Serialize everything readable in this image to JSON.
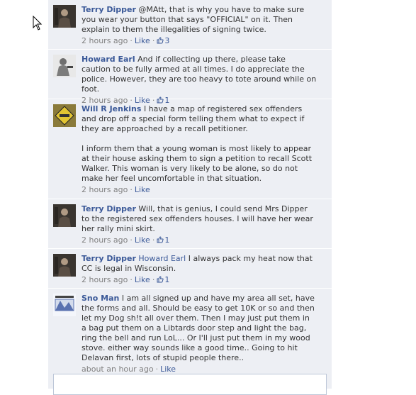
{
  "comments": [
    {
      "author": "Terry Dipper",
      "text": "@MAtt, that is why you have to make sure you wear your button that says \"OFFICIAL\" on it. Then explain to them the illegalities of signing twice.",
      "time": "2 hours ago",
      "like_label": "Like",
      "like_count": "3"
    },
    {
      "author": "Howard Earl",
      "text": "And if collecting up there, please take caution to be fully armed at all times. I do appreciate the police. However, they are too heavy to tote around while on foot.",
      "time": "2 hours ago",
      "like_label": "Like",
      "like_count": "1"
    },
    {
      "author": "Will R Jenkins",
      "text": "I have a map of registered sex offenders and drop off a special form telling them what to expect if they are approached by a recall petitioner.",
      "text2": "I inform them that a young woman is most likely to appear at their house asking them to sign a petition to recall Scott Walker. This woman is very likely to be alone, so do not make her feel uncomfortable in that situation.",
      "time": "2 hours ago",
      "like_label": "Like"
    },
    {
      "author": "Terry Dipper",
      "text": "Will, that is genius, I could send Mrs Dipper to the registered sex offenders houses. I will have her wear her rally mini skirt.",
      "time": "2 hours ago",
      "like_label": "Like",
      "like_count": "1"
    },
    {
      "author": "Terry Dipper",
      "mention": "Howard Earl",
      "text": "I always pack my heat now that CC is legal in Wisconsin.",
      "time": "2 hours ago",
      "like_label": "Like",
      "like_count": "1"
    },
    {
      "author": "Sno Man",
      "text": "I am all signed up and have my area all set, have the forms and all. Should be easy to get 10K or so and then let my Dog sh!t all over them. Then I may just put them in a bag put them on a Libtards door step and light the bag, ring the bell and run LoL... Or I'll just put them in my wood stove. either way sounds like a good time.. Going to hit Delavan first, lots of stupid people there..",
      "time": "about an hour ago",
      "like_label": "Like"
    }
  ],
  "colors": {
    "feed_bg": "#edeff4",
    "link": "#3b5998",
    "meta": "#808080"
  }
}
